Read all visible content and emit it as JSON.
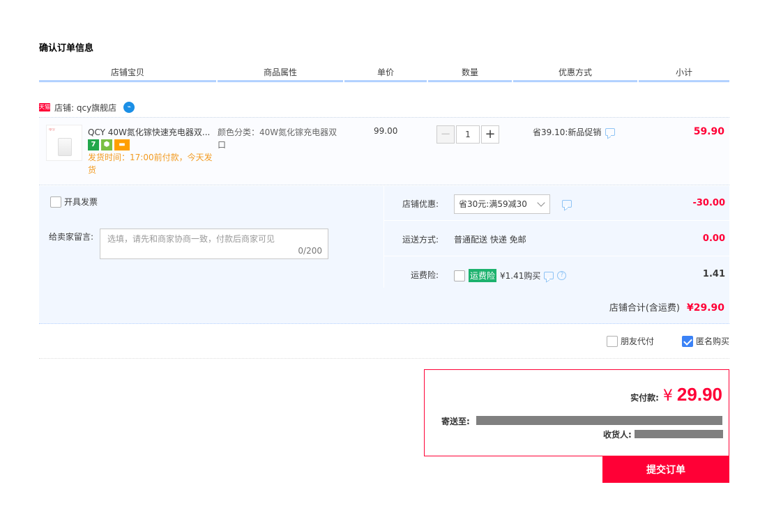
{
  "page_title": "确认订单信息",
  "columns": [
    "店铺宝贝",
    "商品属性",
    "单价",
    "数量",
    "优惠方式",
    "小计"
  ],
  "shop": {
    "badge": "天猫",
    "label": "店铺: qcy旗舰店",
    "wangwang": "⌁"
  },
  "item": {
    "thumb_logo": "qcy",
    "name": "QCY 40W氮化镓快速充电器双...",
    "service_icons": [
      "7",
      "⬢",
      "▬"
    ],
    "ship_time": "发货时间：17:00前付款，今天发货",
    "attr": "颜色分类：40W氮化镓充电器双口",
    "price": "99.00",
    "qty_minus": "−",
    "qty": "1",
    "qty_plus": "+",
    "promo": "省39.10:新品促销",
    "subtotal": "59.90"
  },
  "invoice_label": "开具发票",
  "memo": {
    "label": "给卖家留言:",
    "placeholder": "选填，请先和商家协商一致，付款后商家可见",
    "count": "0/200"
  },
  "store_coupon": {
    "label": "店铺优惠:",
    "selected": "省30元:满59减30",
    "amount": "-30.00"
  },
  "shipping": {
    "label": "运送方式:",
    "value": "普通配送 快递 免邮",
    "amount": "0.00"
  },
  "insurance": {
    "label": "运费险:",
    "badge": "运费险",
    "text": "¥1.41购买",
    "help": "?",
    "amount": "1.41"
  },
  "shop_total": {
    "label": "店铺合计(含运费)",
    "amount": "¥29.90"
  },
  "friend_pay": "朋友代付",
  "anonymous": "匿名购买",
  "payment": {
    "label": "实付款:",
    "currency": "¥",
    "amount": "29.90",
    "address_label": "寄送至:",
    "receiver_label": "收货人:"
  },
  "submit_label": "提交订单",
  "colors": {
    "accent": "#ff0036",
    "header_border": "#b2d1ff",
    "panel_bg": "#f2f7ff"
  }
}
